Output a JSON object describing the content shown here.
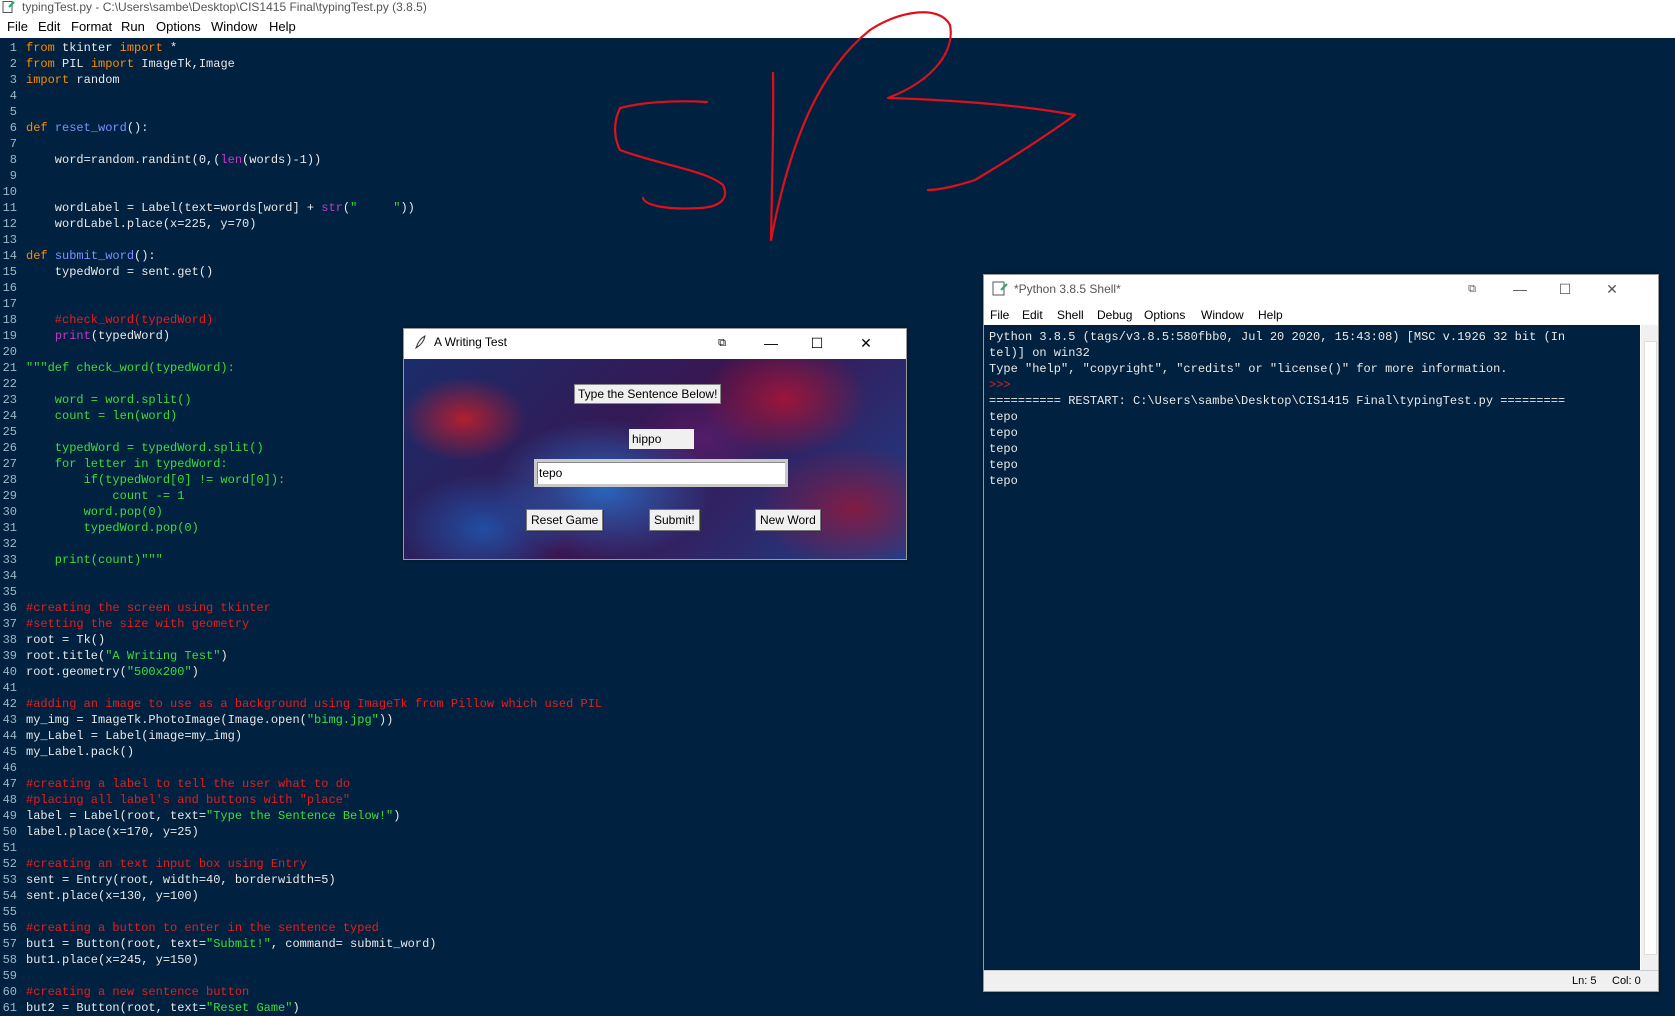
{
  "app": {
    "title": "typingTest.py - C:\\Users\\sambe\\Desktop\\CIS1415 Final\\typingTest.py (3.8.5)",
    "menu": [
      "File",
      "Edit",
      "Format",
      "Run",
      "Options",
      "Window",
      "Help"
    ]
  },
  "code_lines": [
    {
      "n": "1",
      "segs": [
        [
          "kw",
          "from"
        ],
        [
          "t",
          " tkinter "
        ],
        [
          "kw",
          "import"
        ],
        [
          "t",
          " *"
        ]
      ]
    },
    {
      "n": "2",
      "segs": [
        [
          "kw",
          "from"
        ],
        [
          "t",
          " PIL "
        ],
        [
          "kw",
          "import"
        ],
        [
          "t",
          " ImageTk,Image"
        ]
      ]
    },
    {
      "n": "3",
      "segs": [
        [
          "kw",
          "import"
        ],
        [
          "t",
          " random"
        ]
      ]
    },
    {
      "n": "4",
      "segs": []
    },
    {
      "n": "5",
      "segs": []
    },
    {
      "n": "6",
      "segs": [
        [
          "kw",
          "def"
        ],
        [
          "t",
          " "
        ],
        [
          "def",
          "reset_word"
        ],
        [
          "t",
          "():"
        ]
      ]
    },
    {
      "n": "7",
      "segs": []
    },
    {
      "n": "8",
      "segs": [
        [
          "t",
          "    word=random.randint(0,("
        ],
        [
          "bi",
          "len"
        ],
        [
          "t",
          "(words)-1))"
        ]
      ]
    },
    {
      "n": "9",
      "segs": []
    },
    {
      "n": "10",
      "segs": []
    },
    {
      "n": "11",
      "segs": [
        [
          "t",
          "    wordLabel = Label(text=words[word] + "
        ],
        [
          "bi",
          "str"
        ],
        [
          "t",
          "("
        ],
        [
          "str",
          "\"     \""
        ],
        [
          "t",
          "))"
        ]
      ]
    },
    {
      "n": "12",
      "segs": [
        [
          "t",
          "    wordLabel.place(x=225, y=70)"
        ]
      ]
    },
    {
      "n": "13",
      "segs": []
    },
    {
      "n": "14",
      "segs": [
        [
          "kw",
          "def"
        ],
        [
          "t",
          " "
        ],
        [
          "def",
          "submit_word"
        ],
        [
          "t",
          "():"
        ]
      ]
    },
    {
      "n": "15",
      "segs": [
        [
          "t",
          "    typedWord = sent.get()"
        ]
      ]
    },
    {
      "n": "16",
      "segs": []
    },
    {
      "n": "17",
      "segs": []
    },
    {
      "n": "18",
      "segs": [
        [
          "cm",
          "    #check_word(typedWord)"
        ]
      ]
    },
    {
      "n": "19",
      "segs": [
        [
          "t",
          "    "
        ],
        [
          "bi",
          "print"
        ],
        [
          "t",
          "(typedWord)"
        ]
      ]
    },
    {
      "n": "20",
      "segs": []
    },
    {
      "n": "21",
      "segs": [
        [
          "doc",
          "\"\"\"def check_word(typedWord):"
        ]
      ]
    },
    {
      "n": "22",
      "segs": []
    },
    {
      "n": "23",
      "segs": [
        [
          "doc",
          "    word = word.split()"
        ]
      ]
    },
    {
      "n": "24",
      "segs": [
        [
          "doc",
          "    count = len(word)"
        ]
      ]
    },
    {
      "n": "25",
      "segs": []
    },
    {
      "n": "26",
      "segs": [
        [
          "doc",
          "    typedWord = typedWord.split()"
        ]
      ]
    },
    {
      "n": "27",
      "segs": [
        [
          "doc",
          "    for letter in typedWord:"
        ]
      ]
    },
    {
      "n": "28",
      "segs": [
        [
          "doc",
          "        if(typedWord[0] != word[0]):"
        ]
      ]
    },
    {
      "n": "29",
      "segs": [
        [
          "doc",
          "            count -= 1"
        ]
      ]
    },
    {
      "n": "30",
      "segs": [
        [
          "doc",
          "        word.pop(0)"
        ]
      ]
    },
    {
      "n": "31",
      "segs": [
        [
          "doc",
          "        typedWord.pop(0)"
        ]
      ]
    },
    {
      "n": "32",
      "segs": []
    },
    {
      "n": "33",
      "segs": [
        [
          "doc",
          "    print(count)\"\"\""
        ]
      ]
    },
    {
      "n": "34",
      "segs": []
    },
    {
      "n": "35",
      "segs": []
    },
    {
      "n": "36",
      "segs": [
        [
          "cm",
          "#creating the screen using tkinter"
        ]
      ]
    },
    {
      "n": "37",
      "segs": [
        [
          "cm",
          "#setting the size with geometry"
        ]
      ]
    },
    {
      "n": "38",
      "segs": [
        [
          "t",
          "root = Tk()"
        ]
      ]
    },
    {
      "n": "39",
      "segs": [
        [
          "t",
          "root.title("
        ],
        [
          "str",
          "\"A Writing Test\""
        ],
        [
          "t",
          ")"
        ]
      ]
    },
    {
      "n": "40",
      "segs": [
        [
          "t",
          "root.geometry("
        ],
        [
          "str",
          "\"500x200\""
        ],
        [
          "t",
          ")"
        ]
      ]
    },
    {
      "n": "41",
      "segs": []
    },
    {
      "n": "42",
      "segs": [
        [
          "cm",
          "#adding an image to use as a background using ImageTk from Pillow which used PIL"
        ]
      ]
    },
    {
      "n": "43",
      "segs": [
        [
          "t",
          "my_img = ImageTk.PhotoImage(Image.open("
        ],
        [
          "str",
          "\"bimg.jpg\""
        ],
        [
          "t",
          "))"
        ]
      ]
    },
    {
      "n": "44",
      "segs": [
        [
          "t",
          "my_Label = Label(image=my_img)"
        ]
      ]
    },
    {
      "n": "45",
      "segs": [
        [
          "t",
          "my_Label.pack()"
        ]
      ]
    },
    {
      "n": "46",
      "segs": []
    },
    {
      "n": "47",
      "segs": [
        [
          "cm",
          "#creating a label to tell the user what to do"
        ]
      ]
    },
    {
      "n": "48",
      "segs": [
        [
          "cm",
          "#placing all label's and buttons with \"place\""
        ]
      ]
    },
    {
      "n": "49",
      "segs": [
        [
          "t",
          "label = Label(root, text="
        ],
        [
          "str",
          "\"Type the Sentence Below!\""
        ],
        [
          "t",
          ")"
        ]
      ]
    },
    {
      "n": "50",
      "segs": [
        [
          "t",
          "label.place(x=170, y=25)"
        ]
      ]
    },
    {
      "n": "51",
      "segs": []
    },
    {
      "n": "52",
      "segs": [
        [
          "cm",
          "#creating an text input box using Entry"
        ]
      ]
    },
    {
      "n": "53",
      "segs": [
        [
          "t",
          "sent = Entry(root, width=40, borderwidth=5)"
        ]
      ]
    },
    {
      "n": "54",
      "segs": [
        [
          "t",
          "sent.place(x=130, y=100)"
        ]
      ]
    },
    {
      "n": "55",
      "segs": []
    },
    {
      "n": "56",
      "segs": [
        [
          "cm",
          "#creating a button to enter in the sentence typed"
        ]
      ]
    },
    {
      "n": "57",
      "segs": [
        [
          "t",
          "but1 = Button(root, text="
        ],
        [
          "str",
          "\"Submit!\""
        ],
        [
          "t",
          ", command= submit_word)"
        ]
      ]
    },
    {
      "n": "58",
      "segs": [
        [
          "t",
          "but1.place(x=245, y=150)"
        ]
      ]
    },
    {
      "n": "59",
      "segs": []
    },
    {
      "n": "60",
      "segs": [
        [
          "cm",
          "#creating a new sentence button"
        ]
      ]
    },
    {
      "n": "61",
      "segs": [
        [
          "t",
          "but2 = Button(root, text="
        ],
        [
          "str",
          "\"Reset Game\""
        ],
        [
          "t",
          ")"
        ]
      ]
    }
  ],
  "tk_window": {
    "title": "A Writing Test",
    "label": "Type the Sentence Below!",
    "word": "hippo",
    "entry_value": "tepo",
    "buttons": {
      "reset": "Reset Game",
      "submit": "Submit!",
      "new": "New Word"
    }
  },
  "shell": {
    "title": "*Python 3.8.5 Shell*",
    "menu": [
      "File",
      "Edit",
      "Shell",
      "Debug",
      "Options",
      "Window",
      "Help"
    ],
    "lines": [
      "Python 3.8.5 (tags/v3.8.5:580fbb0, Jul 20 2020, 15:43:08) [MSC v.1926 32 bit (In",
      "tel)] on win32",
      "Type \"help\", \"copyright\", \"credits\" or \"license()\" for more information."
    ],
    "prompt": ">>>",
    "restart_line": "========== RESTART: C:\\Users\\sambe\\Desktop\\CIS1415 Final\\typingTest.py =========",
    "output": [
      "tepo",
      "tepo",
      "tepo",
      "tepo",
      "tepo"
    ],
    "status": {
      "ln": "Ln: 5",
      "col": "Col: 0"
    }
  },
  "colors": {
    "editor_bg": "#002240",
    "keyword": "#ff8a00",
    "string": "#3ddc3d",
    "comment": "#e81c1c",
    "scribble": "#e0101a"
  }
}
